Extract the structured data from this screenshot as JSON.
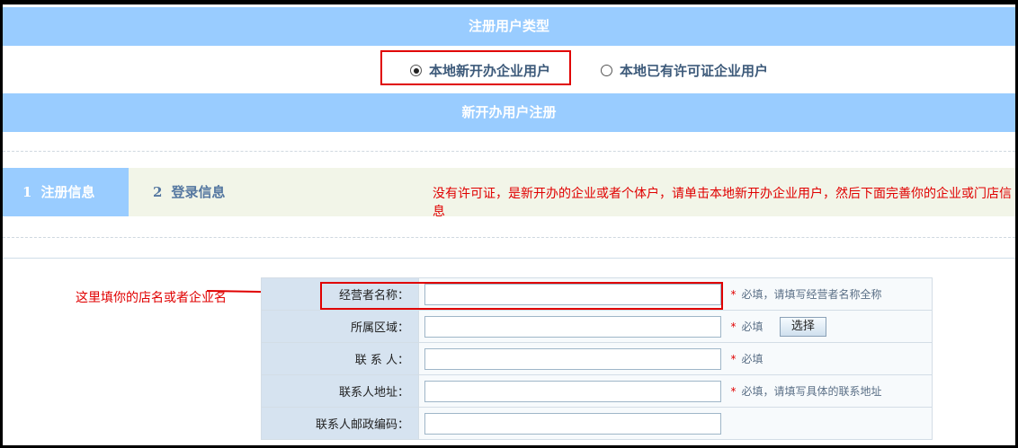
{
  "section1": {
    "title": "注册用户类型"
  },
  "user_type": {
    "options": [
      {
        "label": "本地新开办企业用户",
        "selected": true
      },
      {
        "label": "本地已有许可证企业用户",
        "selected": false
      }
    ]
  },
  "section2": {
    "title": "新开办用户注册"
  },
  "steps": [
    {
      "num": "1",
      "label": "注册信息"
    },
    {
      "num": "2",
      "label": "登录信息"
    }
  ],
  "annotations": {
    "main_note": "没有许可证，是新开办的企业或者个体户，请单击本地新开办企业用户，然后下面完善你的企业或门店信息",
    "left_note": "这里填你的店名或者企业名"
  },
  "form": {
    "rows": [
      {
        "label": "经营者名称：",
        "required": "*",
        "hint": "必填，请填写经营者名称全称"
      },
      {
        "label": "所属区域：",
        "required": "*",
        "hint": "必填",
        "button": "选择"
      },
      {
        "label": "联 系 人：",
        "required": "*",
        "hint": "必填"
      },
      {
        "label": "联系人地址：",
        "required": "*",
        "hint": "必填，请填写具体的联系地址"
      },
      {
        "label": "联系人邮政编码："
      }
    ]
  },
  "colors": {
    "band": "#99ccff",
    "annotation": "#e00000",
    "label_bg": "#d6e3f0"
  }
}
